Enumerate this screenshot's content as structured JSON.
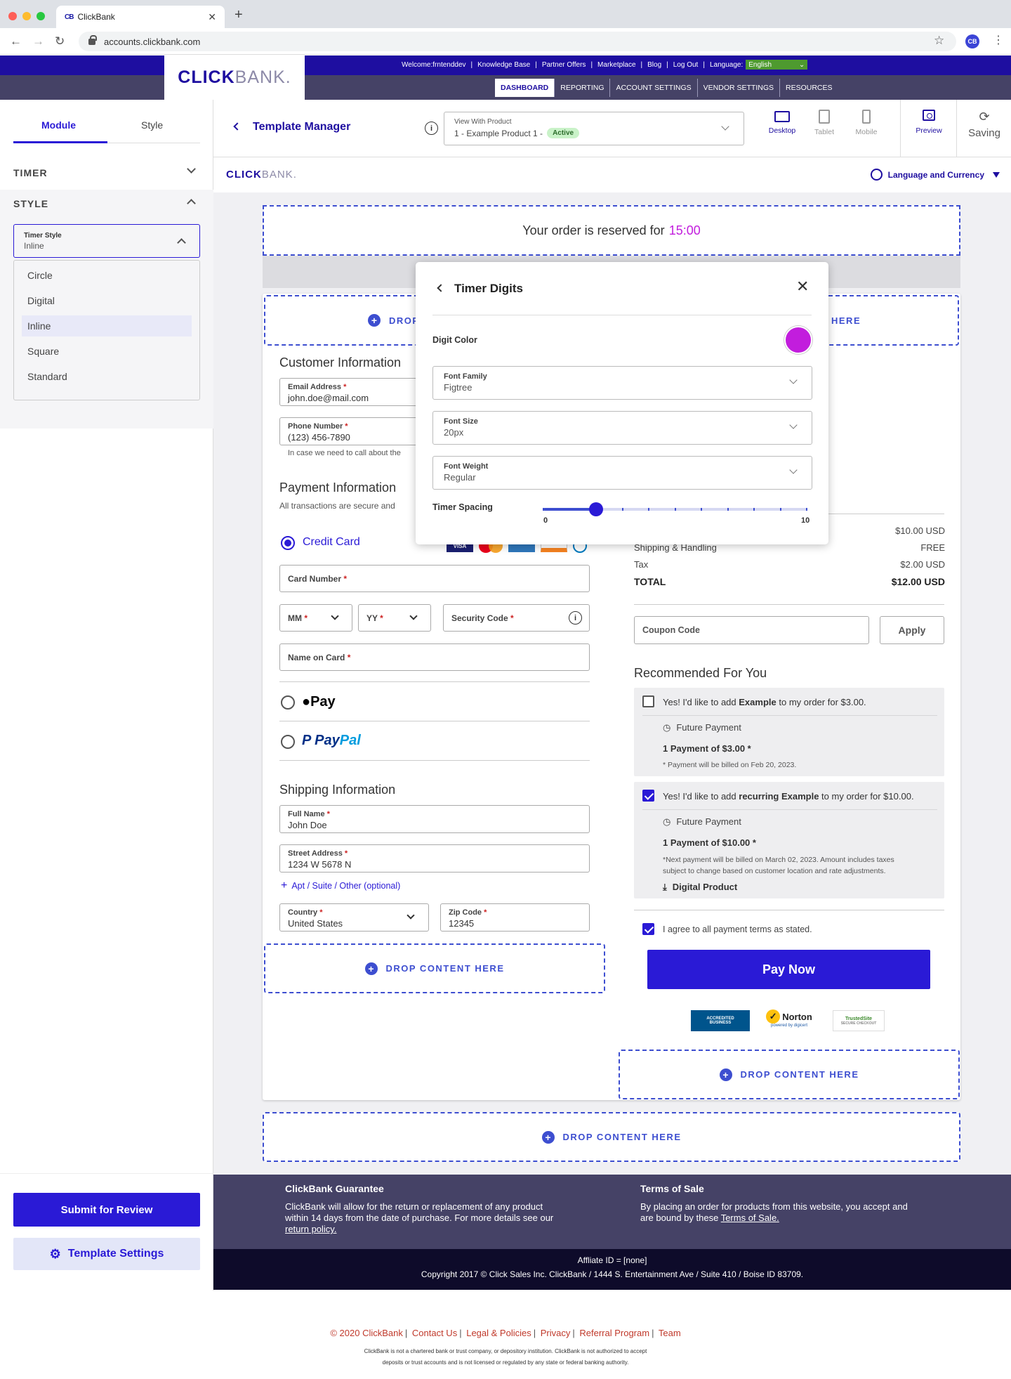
{
  "browser": {
    "tab_title": "ClickBank",
    "tab_favicon": "CB",
    "url": "accounts.clickbank.com",
    "profile_initials": "CB"
  },
  "header": {
    "logo_click": "CLICK",
    "logo_bank": "BANK",
    "logo_dot": ".",
    "welcome": "Welcome:frntenddev",
    "links": [
      "Knowledge Base",
      "Partner Offers",
      "Marketplace",
      "Blog",
      "Log Out"
    ],
    "language_label": "Language:",
    "language_value": "English",
    "nav": [
      "DASHBOARD",
      "REPORTING",
      "ACCOUNT SETTINGS",
      "VENDOR SETTINGS",
      "RESOURCES"
    ],
    "active_nav": "DASHBOARD"
  },
  "left_panel": {
    "tabs": [
      "Module",
      "Style"
    ],
    "active_tab": "Module",
    "sections": [
      "TIMER",
      "STYLE"
    ],
    "timer_style": {
      "label": "Timer Style",
      "value": "Inline"
    },
    "options": [
      "Circle",
      "Digital",
      "Inline",
      "Square",
      "Standard"
    ],
    "selected_option": "Inline",
    "submit_label": "Submit for Review",
    "settings_label": "Template Settings"
  },
  "toolbar": {
    "title": "Template Manager",
    "view_with_label": "View With Product",
    "product_value": "1 - Example Product 1 -",
    "status_badge": "Active",
    "devices": [
      "Desktop",
      "Tablet",
      "Mobile"
    ],
    "active_device": "Desktop",
    "preview_label": "Preview",
    "saving_label": "Saving"
  },
  "page": {
    "logo_click": "CLICK",
    "logo_bank": "BANK",
    "logo_dot": ".",
    "language_currency": "Language and Currency",
    "timer_text": "Your order is reserved for",
    "timer_value": "15:00",
    "drop_label": "DROP CONTENT HERE",
    "drop_partial_left": "DROP",
    "drop_partial_right": "HERE",
    "customer": {
      "title": "Customer Information",
      "email_label": "Email Address",
      "email_value": "john.doe@mail.com",
      "phone_label": "Phone Number",
      "phone_value": "(123) 456-7890",
      "phone_help": "In case we need to call about the"
    },
    "payment": {
      "title": "Payment Information",
      "subtitle": "All transactions are secure and",
      "credit_card": "Credit Card",
      "card_number": "Card Number",
      "mm": "MM",
      "yy": "YY",
      "security_code": "Security Code",
      "name_on_card": "Name on Card",
      "apple_pay": "Pay",
      "paypal_pay": "Pay",
      "paypal_pal": "Pal"
    },
    "shipping": {
      "title": "Shipping Information",
      "full_name_label": "Full Name",
      "full_name_value": "John Doe",
      "street_label": "Street Address",
      "street_value": "1234 W 5678 N",
      "apt_link": "Apt / Suite / Other (optional)",
      "country_label": "Country",
      "country_value": "United States",
      "zip_label": "Zip Code",
      "zip_value": "12345"
    },
    "summary": {
      "subtotal_value": "$10.00 USD",
      "shipping_label": "Shipping & Handling",
      "shipping_value": "FREE",
      "tax_label": "Tax",
      "tax_value": "$2.00 USD",
      "total_label": "TOTAL",
      "total_value": "$12.00 USD",
      "coupon_placeholder": "Coupon Code",
      "apply_label": "Apply"
    },
    "recommended": {
      "title": "Recommended For You",
      "item1_pre": "Yes! I'd like to add",
      "item1_bold": "Example",
      "item1_post": "to my order for $3.00.",
      "item1_checked": false,
      "item1_future": "Future Payment",
      "item1_payment": "1 Payment of $3.00",
      "item1_note": "Payment will be billed on Feb 20, 2023.",
      "item2_pre": "Yes! I'd like to add",
      "item2_bold": "recurring Example",
      "item2_post": "to my order for $10.00.",
      "item2_checked": true,
      "item2_future": "Future Payment",
      "item2_payment": "1 Payment of $10.00",
      "item2_note1": "*Next payment will be billed on March 02, 2023. Amount includes taxes",
      "item2_note2": "subject to change based on customer location and rate adjustments.",
      "item2_digital": "Digital Product"
    },
    "agree_text": "I agree to all payment terms as stated.",
    "pay_now": "Pay Now",
    "trust": {
      "bbb_1": "ACCREDITED",
      "bbb_2": "BUSINESS",
      "norton": "Norton",
      "norton_sub": "powered by digicert",
      "trusted_1": "TrustedSite",
      "trusted_2": "SECURE CHECKOUT"
    }
  },
  "modal": {
    "title": "Timer Digits",
    "digit_color_label": "Digit Color",
    "digit_color": "#c21ddd",
    "font_family_label": "Font Family",
    "font_family_value": "Figtree",
    "font_size_label": "Font Size",
    "font_size_value": "20px",
    "font_weight_label": "Font Weight",
    "font_weight_value": "Regular",
    "spacing_label": "Timer Spacing",
    "spacing_min": "0",
    "spacing_max": "10",
    "spacing_value": 2
  },
  "footer": {
    "guarantee_title": "ClickBank Guarantee",
    "guarantee_1": "ClickBank will allow for the return or replacement of any product",
    "guarantee_2": "within 14 days from the date of purchase. For more details see our",
    "guarantee_link": "return policy.",
    "terms_title": "Terms of Sale",
    "terms_1": "By placing an order for products from this website, you accept and",
    "terms_2": "are bound by these",
    "terms_link": "Terms of Sale.",
    "affiliate": "Affliate ID = [none]",
    "copyright": "Copyright 2017 © Click Sales Inc. ClickBank / 1444 S. Entertainment Ave / Suite 410 / Boise ID 83709."
  },
  "bottom": {
    "links": [
      "© 2020 ClickBank",
      "Contact Us",
      "Legal & Policies",
      "Privacy",
      "Referral Program",
      "Team"
    ],
    "disclaimer_1": "ClickBank is not a chartered bank or trust company, or depository institution. ClickBank is not authorized to accept",
    "disclaimer_2": "deposits or trust accounts and is not licensed or regulated by any state or federal banking authority."
  }
}
